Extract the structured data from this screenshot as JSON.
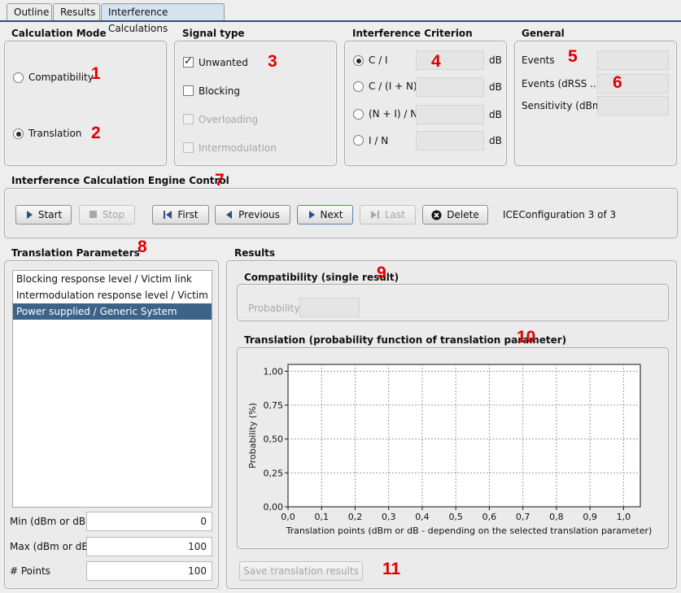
{
  "tabs": [
    "Outline",
    "Results",
    "Interference Calculations"
  ],
  "calc_mode": {
    "title": "Calculation Mode",
    "options": [
      "Compatibility",
      "Translation"
    ],
    "selected": "Translation"
  },
  "signal_type": {
    "title": "Signal type",
    "unwanted": "Unwanted",
    "blocking": "Blocking",
    "overloading": "Overloading",
    "intermodulation": "Intermodulation"
  },
  "criterion": {
    "title": "Interference Criterion",
    "options": [
      "C / I",
      "C / (I + N)",
      "(N + I) / N",
      "I / N"
    ],
    "unit": "dB"
  },
  "general": {
    "title": "General",
    "events": "Events",
    "events_drss": "Events (dRSS ...",
    "sensitivity": "Sensitivity (dBm)"
  },
  "engine": {
    "title": "Interference Calculation Engine Control",
    "start": "Start",
    "stop": "Stop",
    "first": "First",
    "previous": "Previous",
    "next": "Next",
    "last": "Last",
    "delete": "Delete",
    "status": "ICEConfiguration 3 of 3"
  },
  "translation_params": {
    "title": "Translation Parameters",
    "items": [
      "Blocking response level / Victim link",
      "Intermodulation response level / Victim link",
      "Power supplied / Generic System"
    ],
    "min_label": "Min (dBm or dB)",
    "min_value": "0",
    "max_label": "Max (dBm or dB)",
    "max_value": "100",
    "points_label": "# Points",
    "points_value": "100"
  },
  "results": {
    "title": "Results",
    "compat_title": "Compatibility (single result)",
    "probability_label": "Probability",
    "translation_title": "Translation (probability function of translation parameter)",
    "save_button": "Save translation results"
  },
  "markers": [
    "1",
    "2",
    "3",
    "4",
    "5",
    "6",
    "7",
    "8",
    "9",
    "10",
    "11"
  ],
  "chart_data": {
    "type": "line",
    "title": "",
    "xlabel": "Translation points (dBm or dB - depending on the selected translation parameter)",
    "ylabel": "Probability (%)",
    "xlim": [
      0,
      1.05
    ],
    "ylim": [
      0,
      1.05
    ],
    "x_ticks": [
      "0,0",
      "0,1",
      "0,2",
      "0,3",
      "0,4",
      "0,5",
      "0,6",
      "0,7",
      "0,8",
      "0,9",
      "1,0"
    ],
    "y_ticks": [
      "1,00",
      "0,75",
      "0,50",
      "0,25",
      "0,00"
    ],
    "grid": true,
    "series": []
  }
}
